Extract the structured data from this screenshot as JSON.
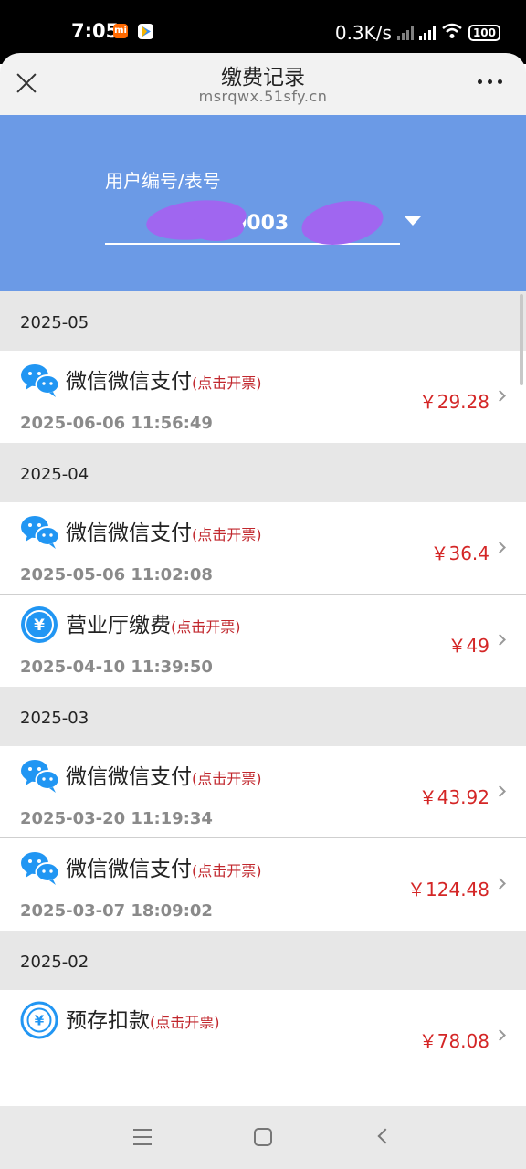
{
  "status_bar": {
    "time": "7:05",
    "net_speed": "0.3K/s",
    "battery": "100"
  },
  "header": {
    "title": "缴费记录",
    "url": "msrqwx.51sfy.cn"
  },
  "account": {
    "label": "用户编号/表号",
    "value_visible": "0003"
  },
  "groups": [
    {
      "month": "2025-05",
      "records": [
        {
          "icon": "wechat-icon",
          "title": "微信微信支付",
          "invoice": "(点击开票)",
          "time": "2025-06-06 11:56:49",
          "amount": "￥29.28"
        }
      ]
    },
    {
      "month": "2025-04",
      "records": [
        {
          "icon": "wechat-icon",
          "title": "微信微信支付",
          "invoice": "(点击开票)",
          "time": "2025-05-06 11:02:08",
          "amount": "￥36.4"
        },
        {
          "icon": "yuan-coin-icon",
          "title": "营业厅缴费",
          "invoice": "(点击开票)",
          "time": "2025-04-10 11:39:50",
          "amount": "￥49"
        }
      ]
    },
    {
      "month": "2025-03",
      "records": [
        {
          "icon": "wechat-icon",
          "title": "微信微信支付",
          "invoice": "(点击开票)",
          "time": "2025-03-20 11:19:34",
          "amount": "￥43.92"
        },
        {
          "icon": "wechat-icon",
          "title": "微信微信支付",
          "invoice": "(点击开票)",
          "time": "2025-03-07 18:09:02",
          "amount": "￥124.48"
        }
      ]
    },
    {
      "month": "2025-02",
      "records": [
        {
          "icon": "yuan-ring-icon",
          "title": "预存扣款",
          "invoice": "(点击开票)",
          "time": "",
          "amount": "￥78.08"
        }
      ]
    }
  ],
  "colors": {
    "banner": "#6b9ae6",
    "amount": "#d42626",
    "invoice_link": "#c1272d",
    "icon_blue": "#2196f3"
  }
}
